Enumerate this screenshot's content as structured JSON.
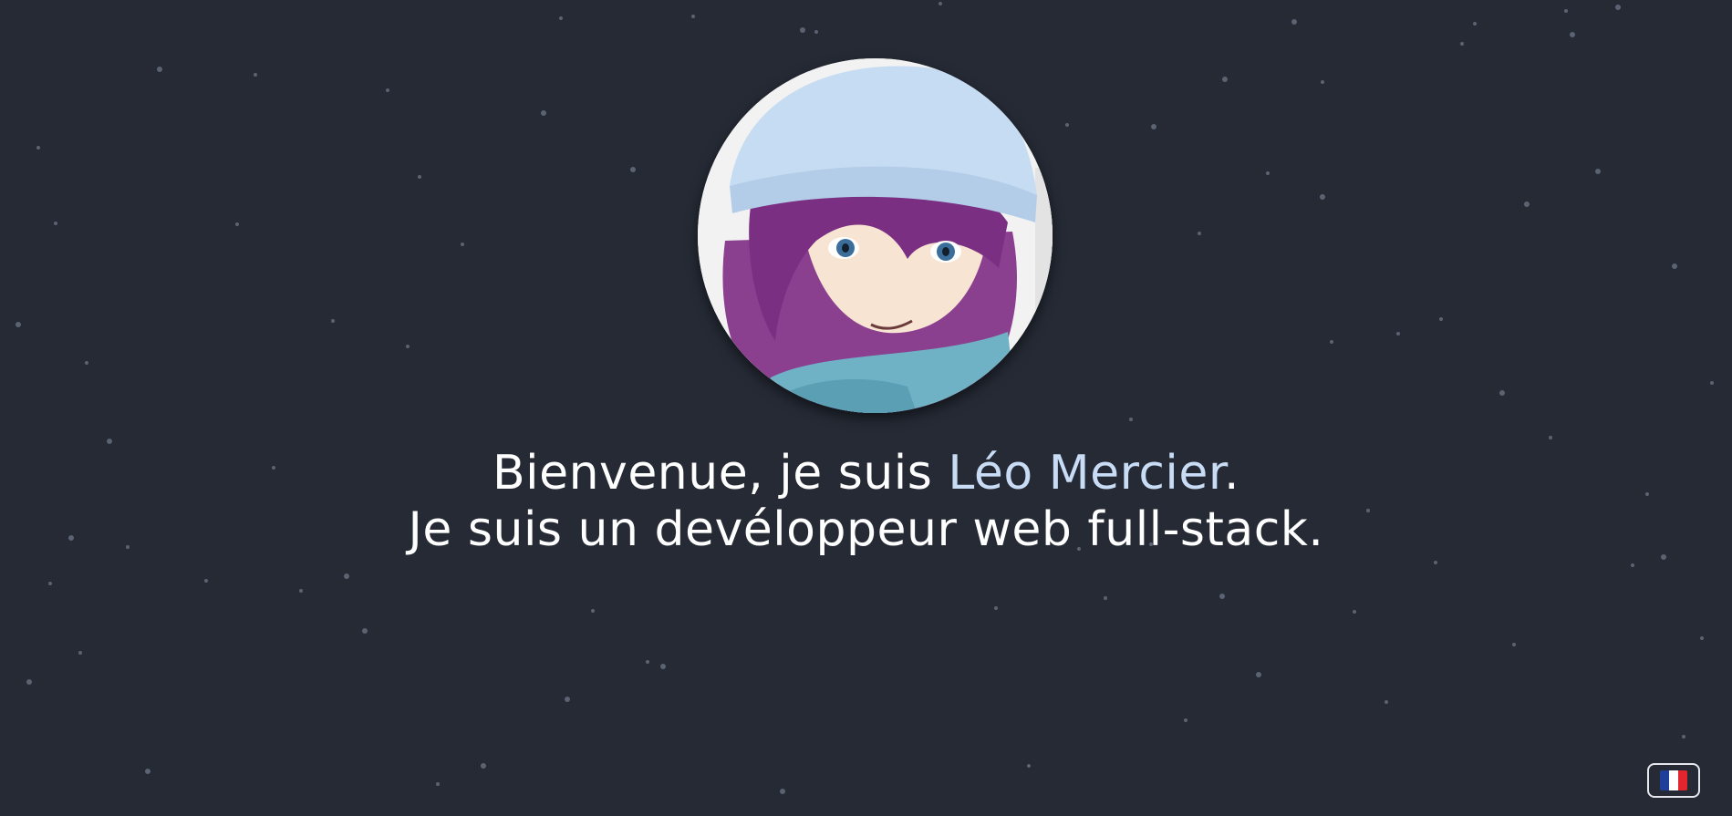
{
  "intro": {
    "line1_prefix": "Bienvenue, je suis ",
    "name": "Léo Mercier",
    "line1_suffix": ".",
    "line2": "Je suis un devéloppeur web full-stack."
  },
  "avatar": {
    "icon": "anime-character-avatar",
    "alt": "avatar"
  },
  "language_toggle": {
    "icon": "french-flag-icon",
    "colors": [
      "#1f3f9a",
      "#ffffff",
      "#e3262e"
    ]
  },
  "colors": {
    "background": "#252a35",
    "text": "#ffffff",
    "accent": "#c8dcf5",
    "star": "#5b6372"
  }
}
